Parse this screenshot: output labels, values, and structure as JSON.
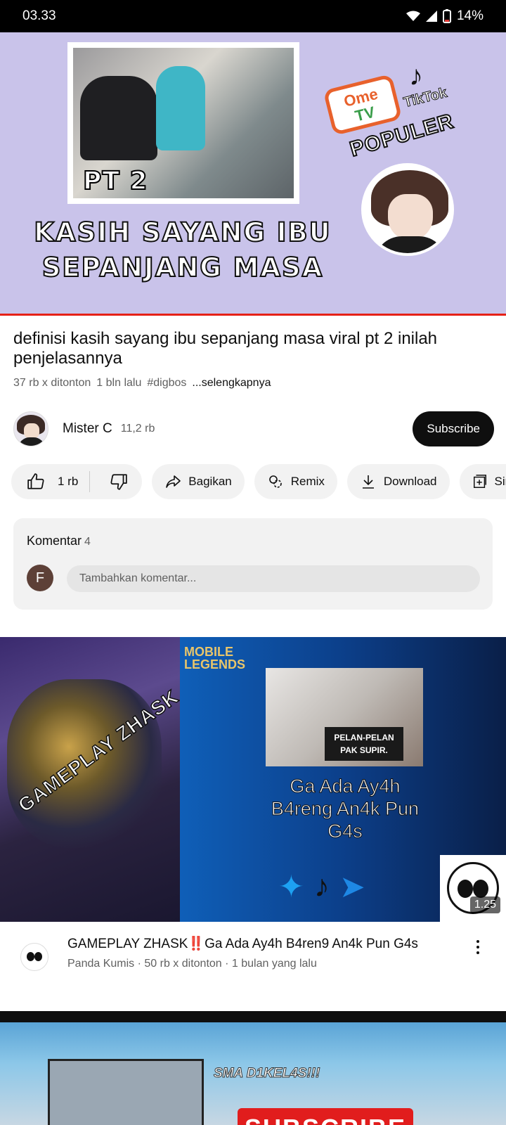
{
  "status_bar": {
    "time": "03.33",
    "battery": "14%"
  },
  "player": {
    "pt_label": "PT 2",
    "caption_line1": "KASIH SAYANG IBU",
    "caption_line2": "SEPANJANG MASA",
    "ometv_line1": "Ome",
    "ometv_line2": "TV",
    "tiktok_label": "TikTok",
    "populer_label": "POPULER",
    "progress_color": "#e62117"
  },
  "video": {
    "title": "definisi kasih sayang ibu sepanjang masa viral pt 2 inilah penjelasannya",
    "views": "37 rb x ditonton",
    "age": "1 bln lalu",
    "hashtag": "#digbos",
    "more": "...selengkapnya"
  },
  "channel": {
    "name": "Mister C",
    "subscribers": "11,2 rb",
    "subscribe_label": "Subscribe"
  },
  "actions": {
    "likes": "1 rb",
    "share_label": "Bagikan",
    "remix_label": "Remix",
    "download_label": "Download",
    "save_label": "Sim"
  },
  "comments": {
    "heading": "Komentar",
    "count": "4",
    "user_initial": "F",
    "placeholder": "Tambahkan komentar..."
  },
  "next_video": {
    "thumb_left_text": "GAMEPLAY ZHASK",
    "logo_line1": "MOBILE",
    "logo_line2": "LEGENDS",
    "photo_label_line1": "PELAN-PELAN",
    "photo_label_line2": "PAK SUPIR.",
    "thumb_caption": "Ga Ada Ay4h B4reng An4k Pun G4s",
    "duration": "1.25",
    "title": "GAMEPLAY ZHASK‼️Ga Ada Ay4h B4ren9 An4k Pun G4s",
    "meta": "Panda Kumis · 50 rb x ditonton · 1 bulan yang lalu"
  },
  "third_video": {
    "thumb_text": "SMA D1KEL4S!!!",
    "subscribe_art": "SUBSCRIBE"
  }
}
